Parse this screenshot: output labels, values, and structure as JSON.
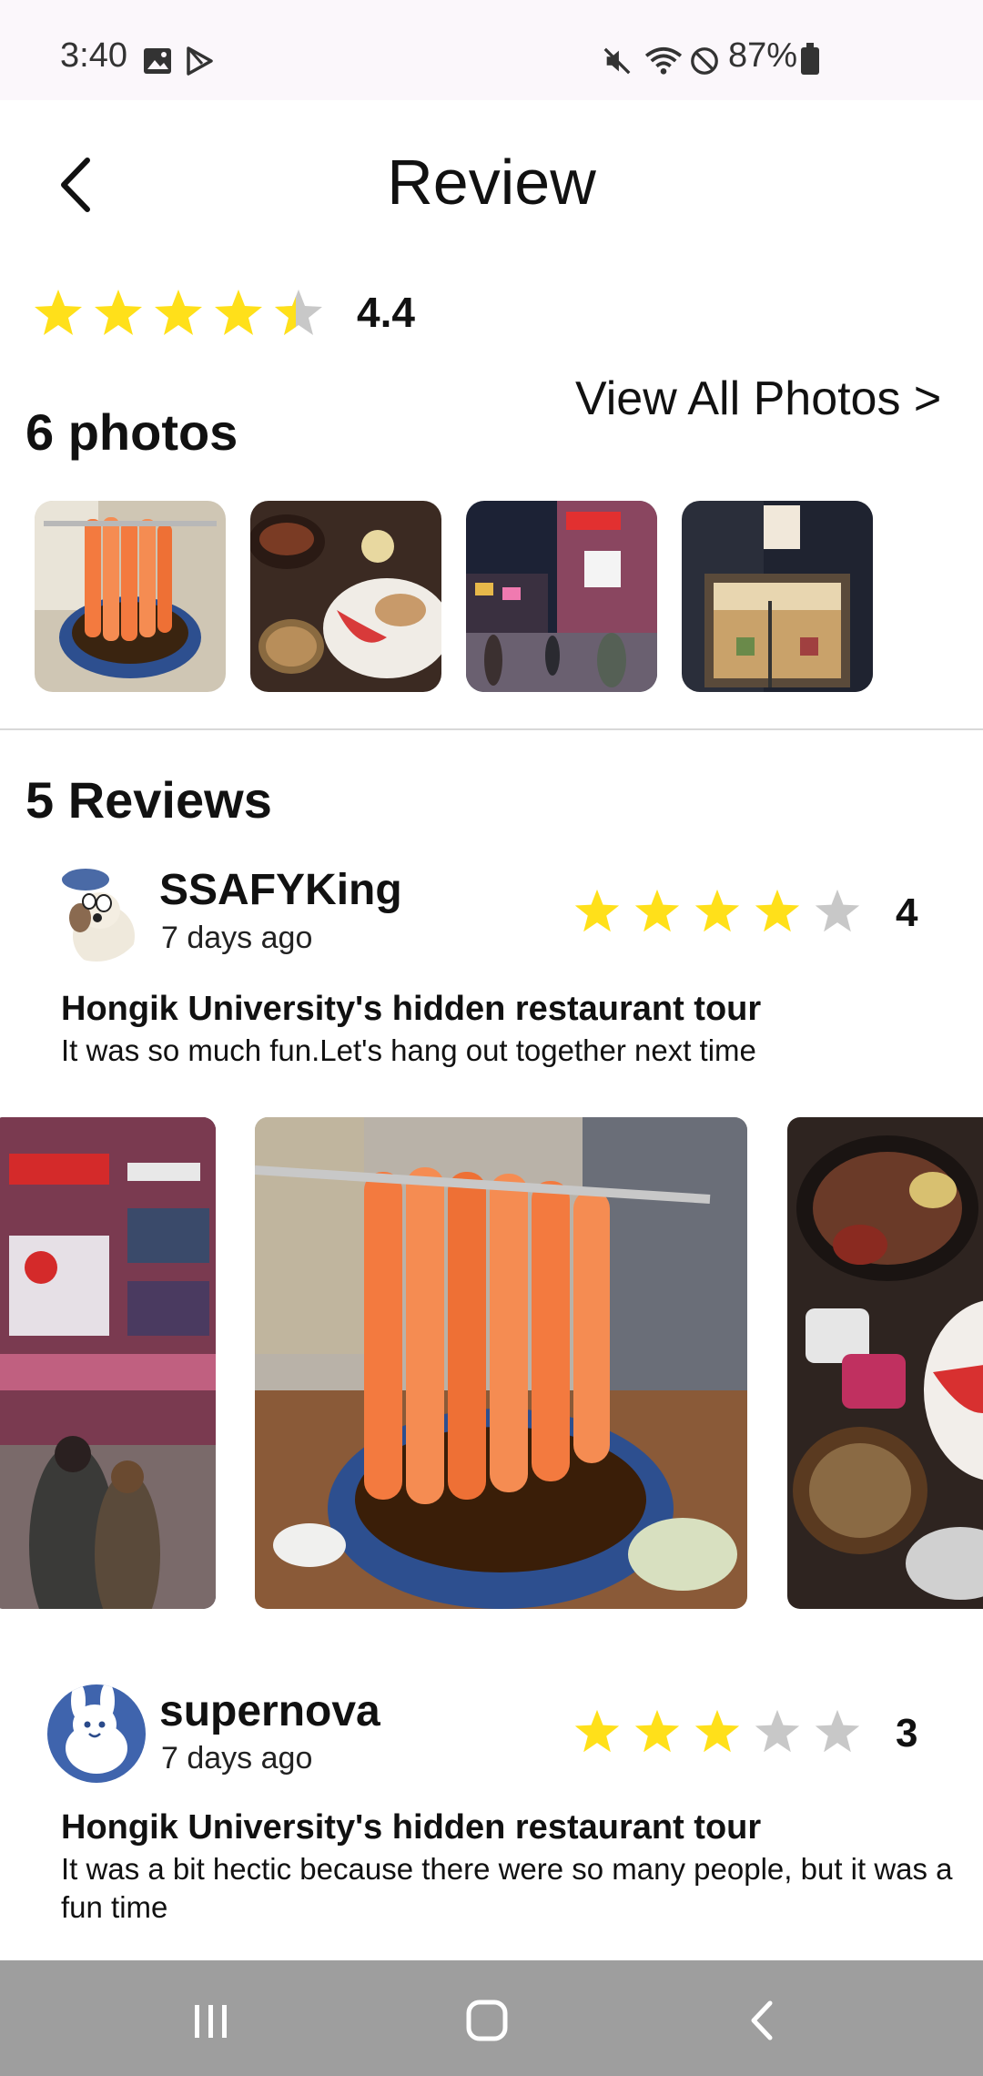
{
  "status_bar": {
    "time": "3:40",
    "battery": "87%",
    "icons": [
      "image-icon",
      "play-store-icon",
      "mute-icon",
      "wifi-icon",
      "block-icon",
      "battery-icon"
    ]
  },
  "header": {
    "title": "Review",
    "back_icon": "chevron-left-icon"
  },
  "summary": {
    "rating_text": "4.4",
    "rating_value": 4.4,
    "stars_max": 5,
    "photos_heading": "6 photos",
    "view_all_label": "View All Photos >",
    "thumbnails": [
      "salmon-dish-photo",
      "steak-platter-photo",
      "street-night-photo",
      "restaurant-storefront-photo"
    ]
  },
  "reviews_section": {
    "heading": "5 Reviews",
    "reviews": [
      {
        "username": "SSAFYKing",
        "date": "7 days ago",
        "rating_text": "4",
        "rating_value": 4,
        "title": "Hongik University's hidden restaurant tour",
        "body": "It was so much fun.Let's hang out together next time",
        "photos": [
          "street-building-photo",
          "salmon-chopsticks-photo",
          "steak-table-photo"
        ]
      },
      {
        "username": "supernova",
        "date": "7 days ago",
        "rating_text": "3",
        "rating_value": 3,
        "title": "Hongik University's hidden restaurant tour",
        "body": "It was a bit hectic because there were so many people, but it was a fun time",
        "photos": []
      }
    ]
  },
  "nav_bar": {
    "icons": [
      "recent-apps-icon",
      "home-icon",
      "back-icon"
    ]
  },
  "colors": {
    "star_filled": "#FFE01A",
    "star_empty": "#C8C8C8",
    "nav_bar": "#9E9E9E"
  }
}
